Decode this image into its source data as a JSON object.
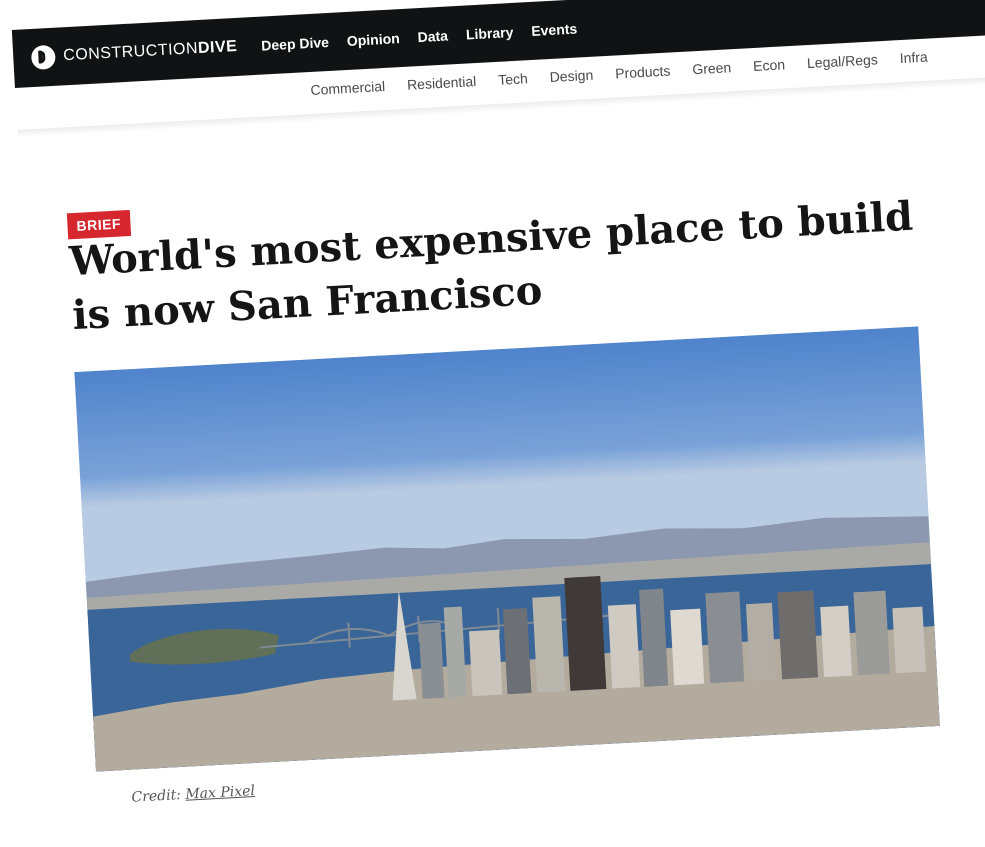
{
  "header": {
    "logo": {
      "word_regular": "CONSTRUCTION",
      "word_bold": "DIVE"
    },
    "nav": [
      "Deep Dive",
      "Opinion",
      "Data",
      "Library",
      "Events"
    ]
  },
  "subnav": [
    "Commercial",
    "Residential",
    "Tech",
    "Design",
    "Products",
    "Green",
    "Econ",
    "Legal/Regs",
    "Infra"
  ],
  "article": {
    "badge": "BRIEF",
    "headline": "World's most expensive place to build is now San Francisco",
    "image_alt": "San Francisco skyline aerial view with the Bay Bridge",
    "credit_label": "Credit:",
    "credit_source": "Max Pixel"
  },
  "colors": {
    "header_bg": "#111214",
    "badge_red": "#d6272e",
    "sky": "#5b8bd0",
    "water": "#3c6699"
  }
}
